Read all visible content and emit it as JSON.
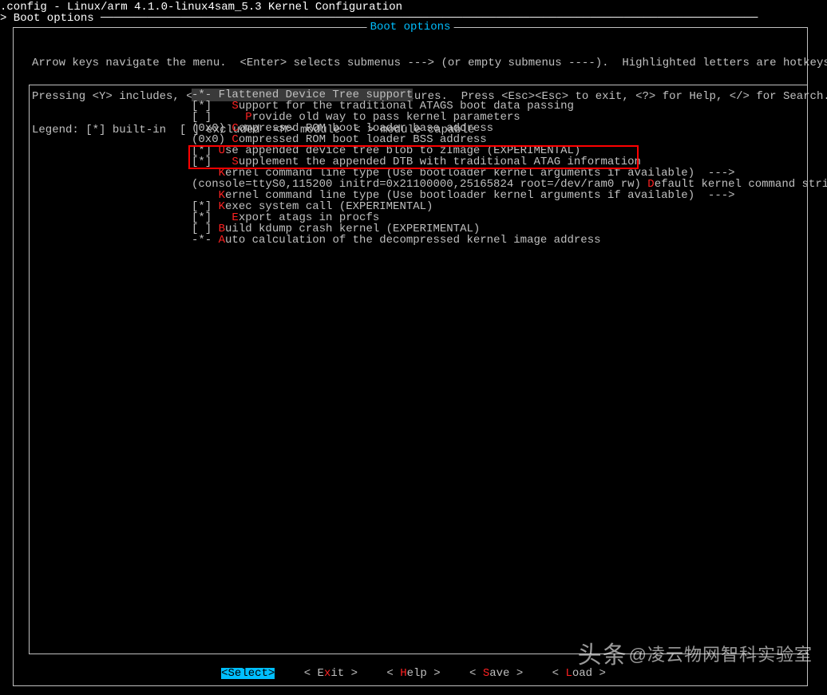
{
  "header": {
    "line1": ".config - Linux/arm 4.1.0-linux4sam_5.3 Kernel Configuration",
    "line2": "> Boot options ──────────────────────────────────────────────────────────────────────────────────────────────────"
  },
  "box_title": "Boot options",
  "instructions": {
    "l1": "Arrow keys navigate the menu.  <Enter> selects submenus ---> (or empty submenus ----).  Highlighted letters are hotkeys.",
    "l2": "Pressing <Y> includes, <N> excludes, <M> modularizes features.  Press <Esc><Esc> to exit, <?> for Help, </> for Search.",
    "l3": "Legend: [*] built-in  [ ] excluded  <M> module  < > module capable"
  },
  "menu": [
    {
      "prefix": "-",
      "mark": "*",
      "suffix": "-",
      "indent": " ",
      "text": "Flattened Device Tree support",
      "hot": "",
      "hilite": true
    },
    {
      "prefix": "[",
      "mark": "*",
      "suffix": "]",
      "indent": "   ",
      "hot": "S",
      "text": "upport for the traditional ATAGS boot data passing"
    },
    {
      "prefix": "[",
      "mark": " ",
      "suffix": "]",
      "indent": "     ",
      "hot": "P",
      "text": "rovide old way to pass kernel parameters"
    },
    {
      "prefix": "(",
      "mark": "0x0",
      "suffix": ")",
      "indent": " ",
      "hot": "C",
      "text": "ompressed ROM boot loader base address"
    },
    {
      "prefix": "(",
      "mark": "0x0",
      "suffix": ")",
      "indent": " ",
      "hot": "C",
      "text": "ompressed ROM boot loader BSS address"
    },
    {
      "prefix": "[",
      "mark": "*",
      "suffix": "]",
      "indent": " ",
      "hot": "U",
      "text": "se appended device tree blob to zImage (EXPERIMENTAL)"
    },
    {
      "prefix": "[",
      "mark": "*",
      "suffix": "]",
      "indent": "   ",
      "hot": "S",
      "text": "upplement the appended DTB with traditional ATAG information"
    },
    {
      "prefix": "",
      "mark": "",
      "suffix": "",
      "indent": "    ",
      "hot": "K",
      "text": "ernel command line type (Use bootloader kernel arguments if available)  --->"
    },
    {
      "prefix": "(",
      "mark": "console=ttyS0,115200 initrd=0x21100000,25165824 root=/dev/ram0 rw",
      "suffix": ")",
      "indent": " ",
      "hot": "D",
      "text": "efault kernel command strin"
    },
    {
      "prefix": "",
      "mark": "",
      "suffix": "",
      "indent": "    ",
      "hot": "K",
      "text": "ernel command line type (Use bootloader kernel arguments if available)  --->"
    },
    {
      "prefix": "[",
      "mark": "*",
      "suffix": "]",
      "indent": " ",
      "hot": "K",
      "text": "exec system call (EXPERIMENTAL)"
    },
    {
      "prefix": "[",
      "mark": "*",
      "suffix": "]",
      "indent": "   ",
      "hot": "E",
      "text": "xport atags in procfs"
    },
    {
      "prefix": "[",
      "mark": " ",
      "suffix": "]",
      "indent": " ",
      "hot": "B",
      "text": "uild kdump crash kernel (EXPERIMENTAL)"
    },
    {
      "prefix": "-",
      "mark": "*",
      "suffix": "-",
      "indent": " ",
      "hot": "A",
      "text": "uto calculation of the decompressed kernel image address"
    }
  ],
  "buttons": {
    "select": "<Select>",
    "exit": "< Exit >",
    "help": "< Help >",
    "save": "< Save >",
    "load": "< Load >"
  },
  "watermark": "凌云物网智科实验室"
}
